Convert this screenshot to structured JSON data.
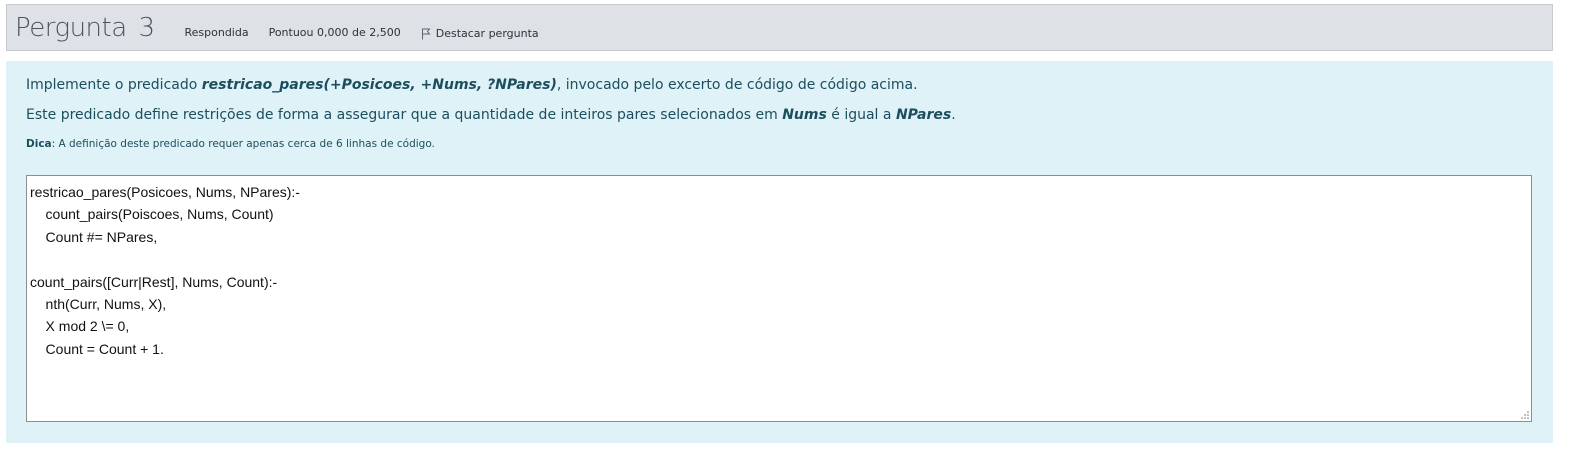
{
  "question": {
    "label": "Pergunta",
    "number": "3",
    "state": "Respondida",
    "grade": "Pontuou 0,000 de 2,500",
    "flag_label": "Destacar pergunta"
  },
  "text": {
    "p1_before": "Implemente o predicado ",
    "p1_code": "restricao_pares(+Posicoes, +Nums, ?NPares)",
    "p1_after": ", invocado pelo excerto de código de código acima.",
    "p2_before": "Este predicado define restrições de forma a assegurar que a quantidade de inteiros pares selecionados em ",
    "p2_nums": "Nums",
    "p2_middle": " é igual a ",
    "p2_npares": "NPares",
    "p2_after": ".",
    "hint_label": "Dica",
    "hint_text": ": A definição deste predicado requer apenas cerca de 6 linhas de código."
  },
  "answer": {
    "lines": [
      "restricao_pares(Posicoes, Nums, NPares):-",
      "    count_pairs(Poiscoes, Nums, Count)",
      "    Count #= NPares,",
      "",
      "count_pairs([Curr|Rest], Nums, Count):-",
      "    nth(Curr, Nums, X),",
      "    X mod 2 \\= 0,",
      "    Count = Count + 1."
    ]
  },
  "colors": {
    "info_bg": "#dee2e6",
    "content_bg": "#def2f8",
    "text": "#1d4e5e"
  }
}
